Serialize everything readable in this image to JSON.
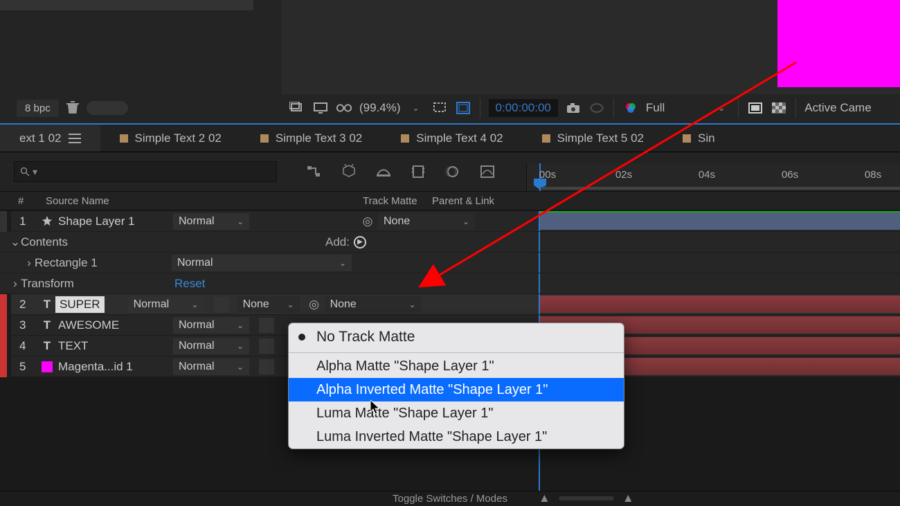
{
  "project": {
    "bpc": "8 bpc"
  },
  "viewer": {
    "zoom": "(99.4%)",
    "timecode": "0:00:00:00",
    "resolution": "Full",
    "active_camera": "Active Came"
  },
  "tabs": [
    {
      "label": "ext 1 02",
      "active": true,
      "showSquare": false
    },
    {
      "label": "Simple Text 2 02",
      "active": false,
      "showSquare": true
    },
    {
      "label": "Simple Text 3 02",
      "active": false,
      "showSquare": true
    },
    {
      "label": "Simple Text 4 02",
      "active": false,
      "showSquare": true
    },
    {
      "label": "Simple Text 5 02",
      "active": false,
      "showSquare": true
    },
    {
      "label": "Sin",
      "active": false,
      "showSquare": true
    }
  ],
  "columns": {
    "hash": "#",
    "source_name": "Source Name",
    "track_matte": "Track Matte",
    "parent_link": "Parent & Link"
  },
  "ruler": [
    "00s",
    "02s",
    "04s",
    "06s",
    "08s"
  ],
  "layers": [
    {
      "num": "1",
      "name": "Shape Layer 1",
      "mode": "Normal",
      "parent": "None",
      "matte": "",
      "color": "grey",
      "icon": "star"
    }
  ],
  "contents": {
    "label": "Contents",
    "add": "Add:",
    "rectangle": "Rectangle 1",
    "rect_mode": "Normal",
    "transform": "Transform",
    "reset": "Reset"
  },
  "text_layers": [
    {
      "num": "2",
      "name": "SUPER",
      "mode": "Normal",
      "matte": "None",
      "parent": "None",
      "color": "red",
      "icon": "T",
      "selected": true
    },
    {
      "num": "3",
      "name": "AWESOME",
      "mode": "Normal",
      "matte": "",
      "parent": "",
      "color": "red",
      "icon": "T"
    },
    {
      "num": "4",
      "name": "TEXT",
      "mode": "Normal",
      "matte": "",
      "parent": "",
      "color": "red",
      "icon": "T"
    },
    {
      "num": "5",
      "name": "Magenta...id 1",
      "mode": "Normal",
      "matte": "",
      "parent": "",
      "color": "red",
      "icon": "swatch",
      "swatch": "#ff00ff"
    }
  ],
  "matte_menu": {
    "selected_index": 2,
    "items": [
      "No Track Matte",
      "Alpha Matte \"Shape Layer 1\"",
      "Alpha Inverted Matte \"Shape Layer 1\"",
      "Luma Matte \"Shape Layer 1\"",
      "Luma Inverted Matte \"Shape Layer 1\""
    ]
  },
  "footer": {
    "toggle": "Toggle Switches / Modes"
  }
}
